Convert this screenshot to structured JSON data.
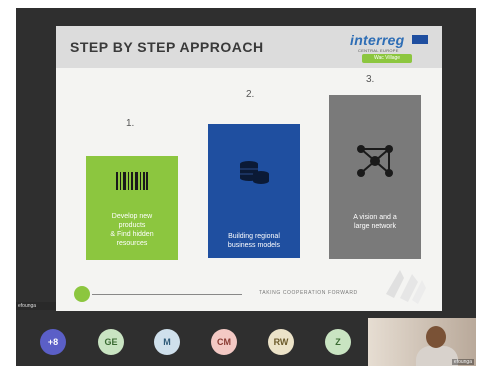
{
  "slide": {
    "title": "STEP BY STEP APPROACH",
    "logo": {
      "word": "interreg",
      "subtitle": "CENTRAL EUROPE",
      "tag": "Wac Village"
    },
    "steps": [
      {
        "number": "1.",
        "label_lines": [
          "Develop new",
          "products",
          "& Find hidden",
          "resources"
        ],
        "icon": "barcode-icon",
        "color": "#8cc63f"
      },
      {
        "number": "2.",
        "label_lines": [
          "Building regional",
          "business models"
        ],
        "icon": "coins-icon",
        "color": "#1f4fa0"
      },
      {
        "number": "3.",
        "label_lines": [
          "A vision and a",
          "large network"
        ],
        "icon": "network-icon",
        "color": "#7a7a7a"
      }
    ],
    "footer": "TAKING COOPERATION FORWARD"
  },
  "presenter_name_tag": "efounga",
  "participants": [
    {
      "initials": "+8",
      "bg": "#5b5fc7",
      "fg": "#ffffff"
    },
    {
      "initials": "GE",
      "bg": "#c9e4c2",
      "fg": "#3b6b33"
    },
    {
      "initials": "M",
      "bg": "#cfe0ec",
      "fg": "#2f5a78"
    },
    {
      "initials": "CM",
      "bg": "#f3c9c4",
      "fg": "#8a3b33"
    },
    {
      "initials": "RW",
      "bg": "#ece3c8",
      "fg": "#6b5a2a"
    },
    {
      "initials": "Z",
      "bg": "#c9e4c2",
      "fg": "#3b6b33"
    }
  ],
  "camera_tile": {
    "name": "efounga"
  }
}
